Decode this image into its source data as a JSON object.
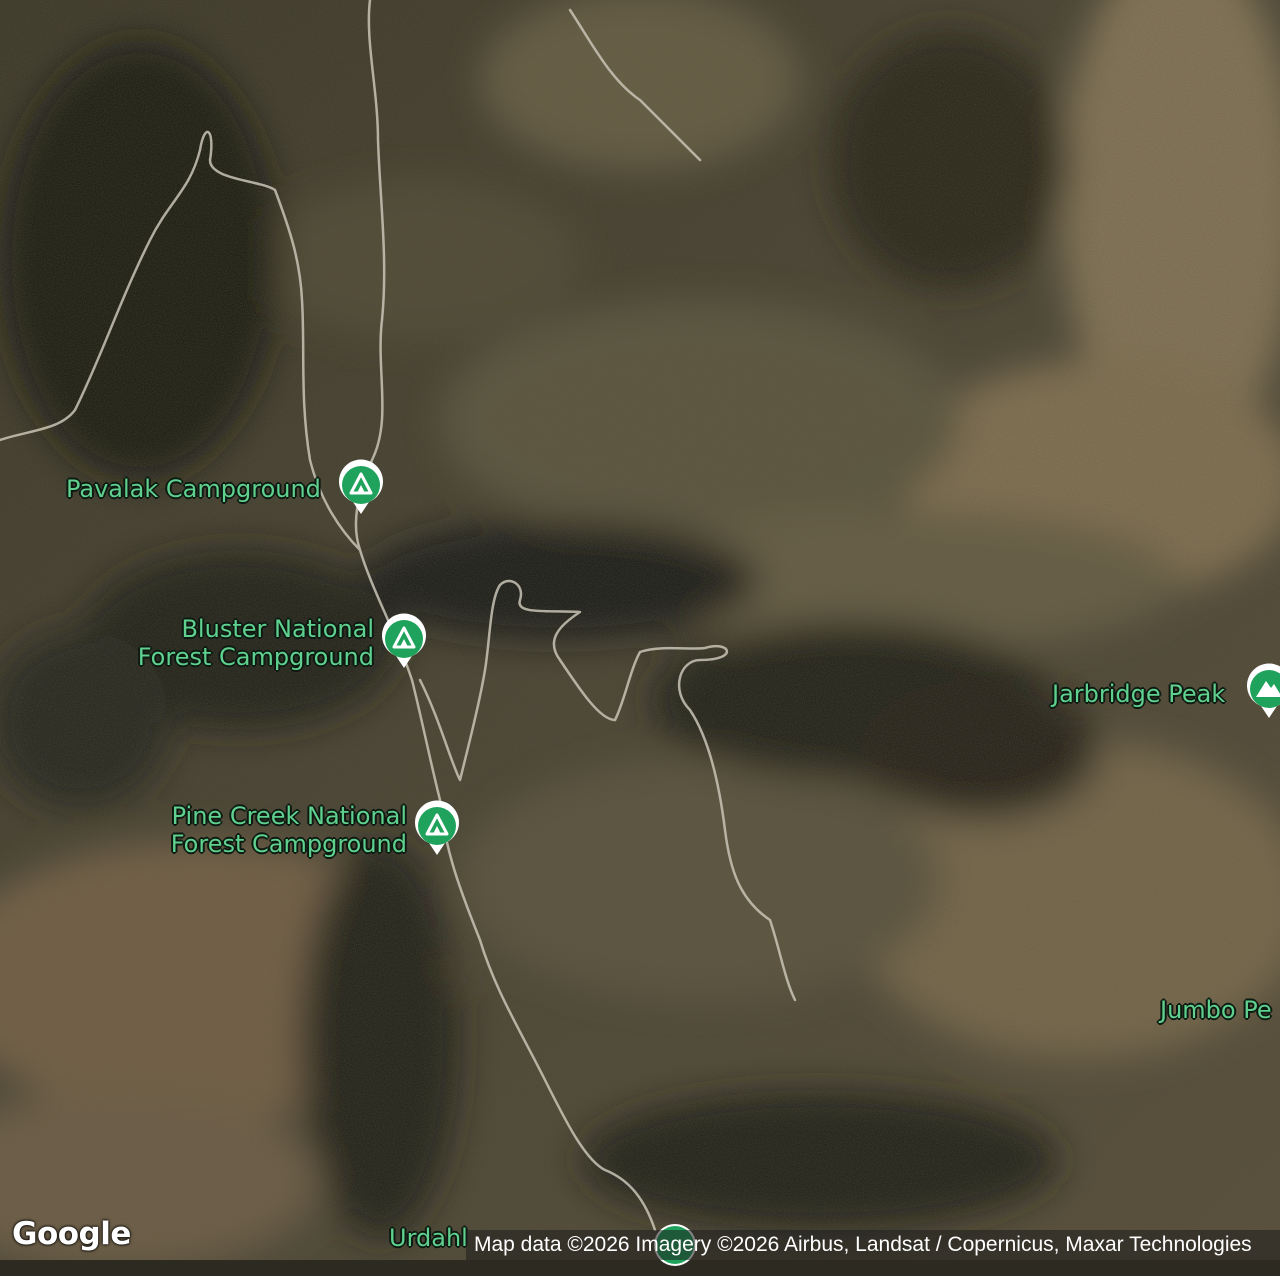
{
  "map": {
    "type": "satellite",
    "colors": {
      "label": "#5fd08e",
      "pin": "#1fa35c",
      "road": "#c9c4b6"
    }
  },
  "places": {
    "pavalak": {
      "name": "Pavalak Campground",
      "icon": "campground-icon"
    },
    "bluster": {
      "line1": "Bluster National",
      "line2": "Forest Campground",
      "icon": "campground-icon"
    },
    "pine_creek": {
      "line1": "Pine Creek National",
      "line2": "Forest Campground",
      "icon": "campground-icon"
    },
    "jarbridge": {
      "name": "Jarbridge Peak",
      "icon": "mountain-icon"
    },
    "jumbo": {
      "name": "Jumbo Pe"
    },
    "urdahl": {
      "name": "Urdahl"
    }
  },
  "branding": {
    "logo": "Google"
  },
  "attribution": "Map data ©2026 Imagery ©2026 Airbus, Landsat / Copernicus, Maxar Technologies"
}
